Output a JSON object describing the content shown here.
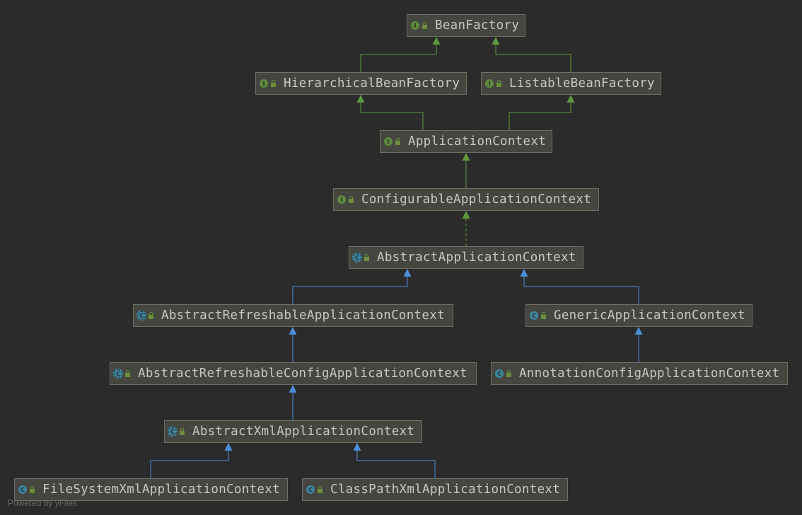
{
  "diagram": {
    "nodes": [
      {
        "id": "BeanFactory",
        "label": "BeanFactory",
        "kind": "interface",
        "kind_letter": "I"
      },
      {
        "id": "HierarchicalBeanFactory",
        "label": "HierarchicalBeanFactory",
        "kind": "interface",
        "kind_letter": "I"
      },
      {
        "id": "ListableBeanFactory",
        "label": "ListableBeanFactory",
        "kind": "interface",
        "kind_letter": "I"
      },
      {
        "id": "ApplicationContext",
        "label": "ApplicationContext",
        "kind": "interface",
        "kind_letter": "I"
      },
      {
        "id": "ConfigurableApplicationContext",
        "label": "ConfigurableApplicationContext",
        "kind": "interface",
        "kind_letter": "I"
      },
      {
        "id": "AbstractApplicationContext",
        "label": "AbstractApplicationContext",
        "kind": "abstract",
        "kind_letter": "C"
      },
      {
        "id": "AbstractRefreshableApplicationContext",
        "label": "AbstractRefreshableApplicationContext",
        "kind": "abstract",
        "kind_letter": "C"
      },
      {
        "id": "GenericApplicationContext",
        "label": "GenericApplicationContext",
        "kind": "class",
        "kind_letter": "C"
      },
      {
        "id": "AbstractRefreshableConfigApplicationContext",
        "label": "AbstractRefreshableConfigApplicationContext",
        "kind": "abstract",
        "kind_letter": "C"
      },
      {
        "id": "AnnotationConfigApplicationContext",
        "label": "AnnotationConfigApplicationContext",
        "kind": "class",
        "kind_letter": "C"
      },
      {
        "id": "AbstractXmlApplicationContext",
        "label": "AbstractXmlApplicationContext",
        "kind": "abstract",
        "kind_letter": "C"
      },
      {
        "id": "FileSystemXmlApplicationContext",
        "label": "FileSystemXmlApplicationContext",
        "kind": "class",
        "kind_letter": "C"
      },
      {
        "id": "ClassPathXmlApplicationContext",
        "label": "ClassPathXmlApplicationContext",
        "kind": "class",
        "kind_letter": "C"
      }
    ],
    "edges": [
      {
        "from": "HierarchicalBeanFactory",
        "to": "BeanFactory",
        "type": "extends-interface"
      },
      {
        "from": "ListableBeanFactory",
        "to": "BeanFactory",
        "type": "extends-interface"
      },
      {
        "from": "ApplicationContext",
        "to": "HierarchicalBeanFactory",
        "type": "extends-interface"
      },
      {
        "from": "ApplicationContext",
        "to": "ListableBeanFactory",
        "type": "extends-interface"
      },
      {
        "from": "ConfigurableApplicationContext",
        "to": "ApplicationContext",
        "type": "extends-interface"
      },
      {
        "from": "AbstractApplicationContext",
        "to": "ConfigurableApplicationContext",
        "type": "implements"
      },
      {
        "from": "AbstractRefreshableApplicationContext",
        "to": "AbstractApplicationContext",
        "type": "extends-class"
      },
      {
        "from": "GenericApplicationContext",
        "to": "AbstractApplicationContext",
        "type": "extends-class"
      },
      {
        "from": "AbstractRefreshableConfigApplicationContext",
        "to": "AbstractRefreshableApplicationContext",
        "type": "extends-class"
      },
      {
        "from": "AnnotationConfigApplicationContext",
        "to": "GenericApplicationContext",
        "type": "extends-class"
      },
      {
        "from": "AbstractXmlApplicationContext",
        "to": "AbstractRefreshableConfigApplicationContext",
        "type": "extends-class"
      },
      {
        "from": "FileSystemXmlApplicationContext",
        "to": "AbstractXmlApplicationContext",
        "type": "extends-class"
      },
      {
        "from": "ClassPathXmlApplicationContext",
        "to": "AbstractXmlApplicationContext",
        "type": "extends-class"
      }
    ]
  },
  "colors": {
    "background": "#2b2b2b",
    "interface_edge": "#5f9a3e",
    "class_edge": "#4c8fdc",
    "node_fill": "#45463f",
    "node_border": "#6f6f66",
    "node_text": "#c8c8c0"
  },
  "icons": {
    "interface": "interface-icon",
    "class": "class-icon",
    "abstract": "abstract-class-icon",
    "visibility": "public-lock-icon"
  },
  "footer": {
    "watermark": "Powered by yFiles"
  }
}
